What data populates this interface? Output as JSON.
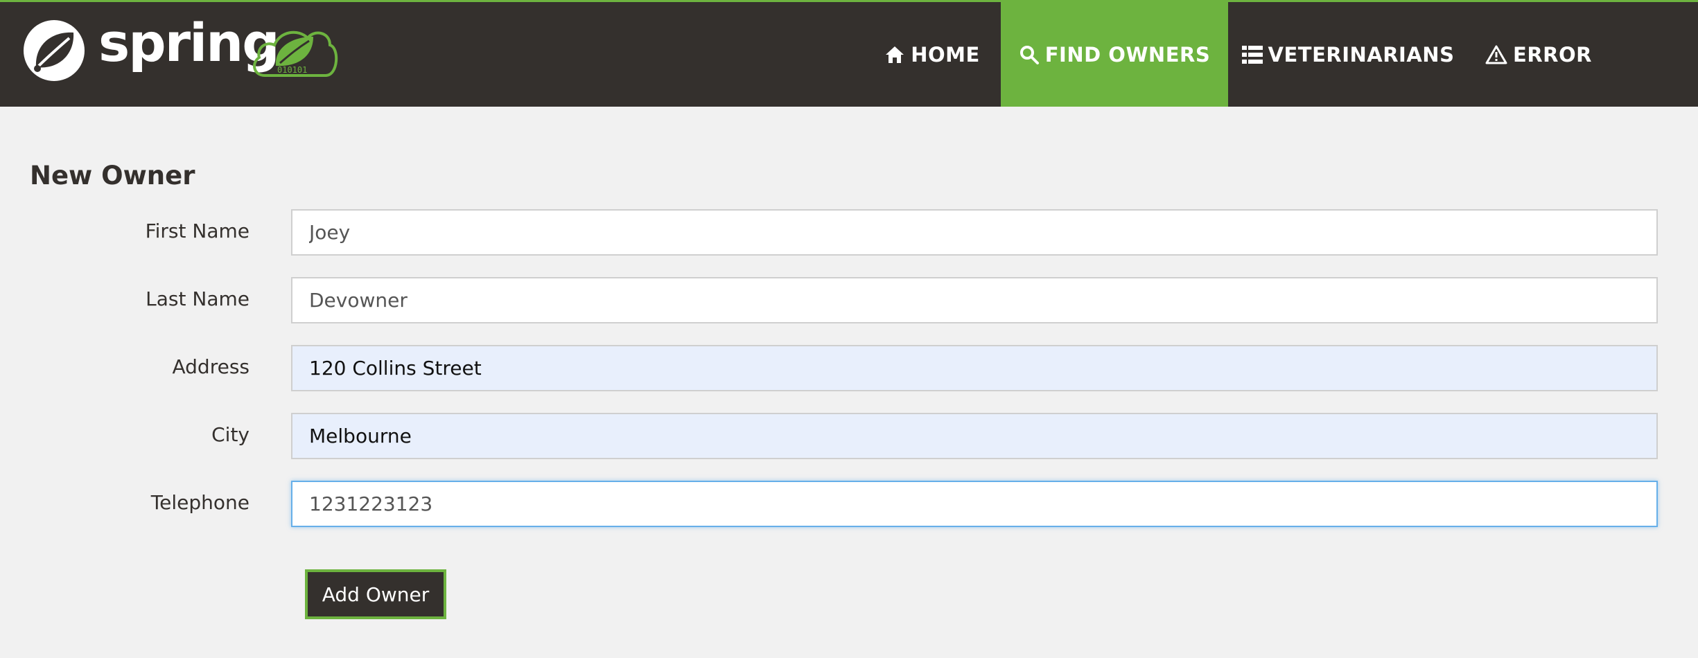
{
  "brand": {
    "name": "spring",
    "badge_digits": "010101"
  },
  "nav": {
    "items": [
      {
        "label": "HOME",
        "icon": "home-icon"
      },
      {
        "label": "FIND OWNERS",
        "icon": "search-icon",
        "active": true
      },
      {
        "label": "VETERINARIANS",
        "icon": "list-icon"
      },
      {
        "label": "ERROR",
        "icon": "warning-icon"
      }
    ]
  },
  "page": {
    "title": "New Owner"
  },
  "form": {
    "fields": [
      {
        "label": "First Name",
        "value": "Joey"
      },
      {
        "label": "Last Name",
        "value": "Devowner"
      },
      {
        "label": "Address",
        "value": "120 Collins Street"
      },
      {
        "label": "City",
        "value": "Melbourne"
      },
      {
        "label": "Telephone",
        "value": "1231223123"
      }
    ],
    "submit_label": "Add Owner"
  },
  "colors": {
    "navbar": "#34302d",
    "accent": "#6db33f",
    "background": "#f1f1f1",
    "autofill": "#e8effc",
    "focus": "#66afe9"
  }
}
